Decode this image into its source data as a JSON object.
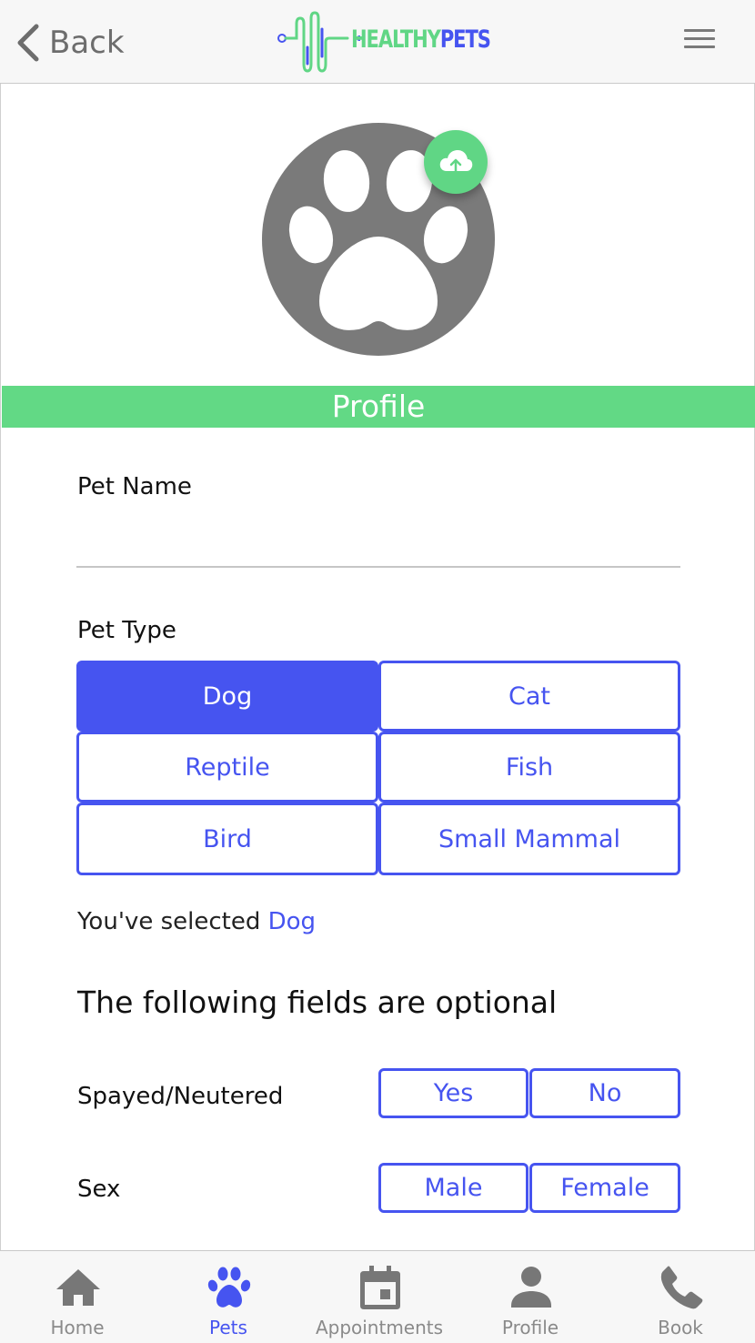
{
  "header": {
    "back_label": "Back",
    "logo_part1": "HEALTHY",
    "logo_part2": "PETS"
  },
  "section_title": "Profile",
  "form": {
    "pet_name_label": "Pet Name",
    "pet_name_value": "",
    "pet_type_label": "Pet Type",
    "pet_types": [
      "Dog",
      "Cat",
      "Reptile",
      "Fish",
      "Bird",
      "Small Mammal"
    ],
    "selected_prefix": "You've selected ",
    "selected_value": "Dog",
    "optional_title": "The following fields are optional",
    "spayed_label": "Spayed/Neutered",
    "spayed_options": [
      "Yes",
      "No"
    ],
    "sex_label": "Sex",
    "sex_options": [
      "Male",
      "Female"
    ]
  },
  "nav": {
    "items": [
      {
        "label": "Home",
        "icon": "home-icon"
      },
      {
        "label": "Pets",
        "icon": "paw-icon"
      },
      {
        "label": "Appointments",
        "icon": "calendar-icon"
      },
      {
        "label": "Profile",
        "icon": "person-icon"
      },
      {
        "label": "Book",
        "icon": "phone-icon"
      }
    ],
    "active": "Pets"
  },
  "colors": {
    "accent": "#4654f0",
    "brand_green": "#60d685",
    "avatar_gray": "#7a7a7a",
    "header_bg": "#f7f7f7"
  }
}
